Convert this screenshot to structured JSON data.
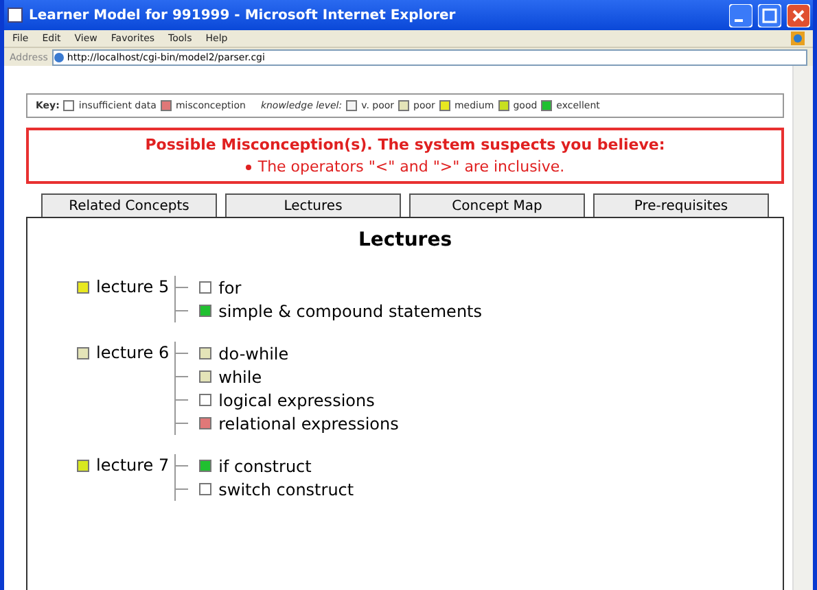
{
  "window": {
    "title": "Learner Model for 991999 - Microsoft Internet Explorer"
  },
  "menu": [
    "File",
    "Edit",
    "View",
    "Favorites",
    "Tools",
    "Help"
  ],
  "address": {
    "label": "Address",
    "value": "http://localhost/cgi-bin/model2/parser.cgi"
  },
  "key": {
    "label": "Key:",
    "items": [
      {
        "label": "insufficient data",
        "color": "#ffffff"
      },
      {
        "label": "misconception",
        "color": "#e07878"
      }
    ],
    "level_label": "knowledge level:",
    "levels": [
      {
        "label": "v. poor",
        "color": "#f4f4f4"
      },
      {
        "label": "poor",
        "color": "#e4e4b8"
      },
      {
        "label": "medium",
        "color": "#e8e820"
      },
      {
        "label": "good",
        "color": "#c8e020"
      },
      {
        "label": "excellent",
        "color": "#20c030"
      }
    ]
  },
  "alert": {
    "title": "Possible Misconception(s). The system suspects you believe:",
    "items": [
      "The operators \"<\" and \">\" are inclusive."
    ]
  },
  "tabs": [
    "Related Concepts",
    "Lectures",
    "Concept Map",
    "Pre-requisites"
  ],
  "panel": {
    "heading": "Lectures",
    "lectures": [
      {
        "label": "lecture 5",
        "color": "#e8e820",
        "children": [
          {
            "label": "for",
            "color": "#ffffff"
          },
          {
            "label": "simple & compound statements",
            "color": "#20c030"
          }
        ]
      },
      {
        "label": "lecture 6",
        "color": "#e4e4b8",
        "children": [
          {
            "label": "do-while",
            "color": "#e4e4b8"
          },
          {
            "label": "while",
            "color": "#e4e4b8"
          },
          {
            "label": "logical expressions",
            "color": "#ffffff"
          },
          {
            "label": "relational expressions",
            "color": "#e07878"
          }
        ]
      },
      {
        "label": "lecture 7",
        "color": "#d8e820",
        "children": [
          {
            "label": "if construct",
            "color": "#20c030"
          },
          {
            "label": "switch construct",
            "color": "#ffffff"
          }
        ]
      }
    ]
  }
}
